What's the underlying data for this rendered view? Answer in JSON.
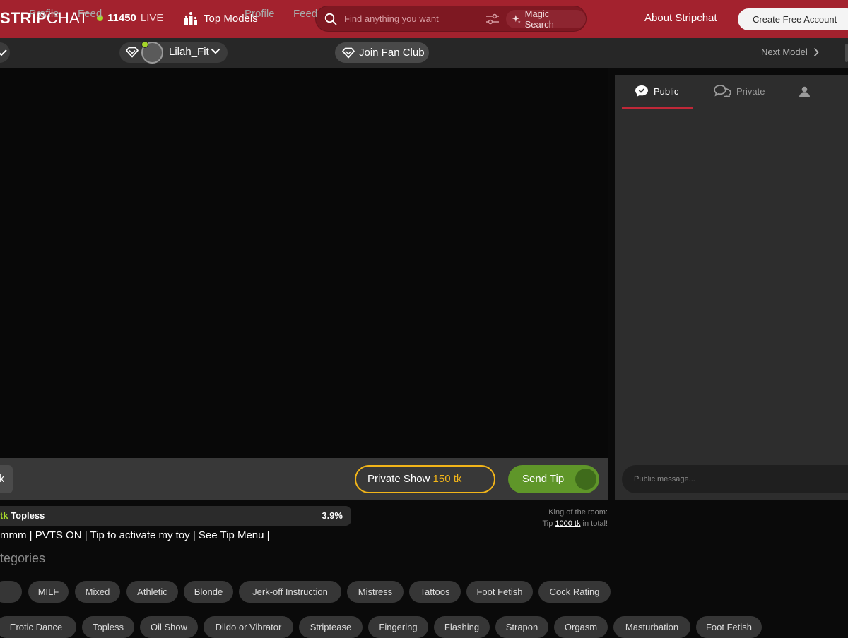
{
  "header": {
    "logo_bold": "STRIP",
    "logo_light": "CHAT",
    "live_count": "11450",
    "live_label": "LIVE",
    "top_models": "Top Models",
    "search_placeholder": "Find anything you want",
    "magic_search": "Magic Search",
    "about": "About Stripchat",
    "create_account": "Create Free Account"
  },
  "subnav": {
    "left_profile": "Profile",
    "left_feed": "Feed",
    "model_name": "Lilah_Fit",
    "profile": "Profile",
    "feed": "Feed",
    "join_fan_club": "Join Fan Club",
    "next_model": "Next Model"
  },
  "controls": {
    "left_button": "k",
    "private_label": "Private Show",
    "private_price": "150 tk",
    "send_tip": "Send Tip"
  },
  "goal": {
    "prefix": "tk",
    "label": "Topless",
    "percent": "3.9%"
  },
  "king": {
    "line1": "King of the room:",
    "tip_prefix": "Tip",
    "tip_amount": "1000 tk",
    "tip_suffix": "in total!"
  },
  "topic": "mmm | PVTS ON | Tip to activate my toy | See Tip Menu |",
  "categories_heading": "tegories",
  "tags_row1": [
    "",
    "MILF",
    "Mixed",
    "Athletic",
    "Blonde",
    "Jerk-off Instruction",
    "Mistress",
    "Tattoos",
    "Foot Fetish",
    "Cock Rating"
  ],
  "tags_row2": [
    "Erotic Dance",
    "Topless",
    "Oil Show",
    "Dildo or Vibrator",
    "Striptease",
    "Fingering",
    "Flashing",
    "Strapon",
    "Orgasm",
    "Masturbation",
    "Foot Fetish"
  ],
  "chat": {
    "tab_public": "Public",
    "tab_private": "Private",
    "input_placeholder": "Public message..."
  },
  "colors": {
    "brand": "#a3222e",
    "live_dot": "#a5d62a",
    "private_accent": "#f2b519",
    "tip_green": "#5f9629",
    "tab_underline": "#c02838"
  }
}
